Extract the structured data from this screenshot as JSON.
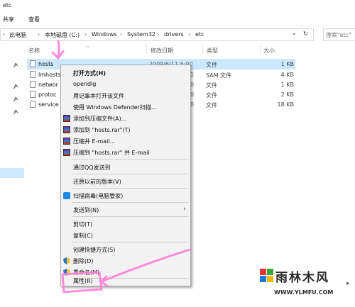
{
  "window": {
    "title": "etc"
  },
  "ribbon": {
    "tabs": [
      "共享",
      "查看"
    ]
  },
  "address": {
    "crumbs": [
      "此电脑",
      "本地磁盘 (C:)",
      "Windows",
      "System32",
      "drivers",
      "etc"
    ],
    "separator": "›",
    "dropdown": "⌄",
    "refresh": "↻"
  },
  "search": {
    "placeholder": "搜索\"etc\""
  },
  "columns": {
    "name": "名称",
    "date": "修改日期",
    "type": "类型",
    "size": "大小"
  },
  "files": [
    {
      "name": "hosts",
      "date": "2009/6/11 5:00",
      "type": "文件",
      "size": "1 KB",
      "selected": true
    },
    {
      "name": "lmhosts",
      "date": "21",
      "type": "SAM 文件",
      "size": "4 KB",
      "selected": false
    },
    {
      "name": "networ",
      "date": "0",
      "type": "文件",
      "size": "1 KB",
      "selected": false
    },
    {
      "name": "protoc",
      "date": "0",
      "type": "文件",
      "size": "2 KB",
      "selected": false
    },
    {
      "name": "service",
      "date": "0",
      "type": "文件",
      "size": "18 KB",
      "selected": false
    }
  ],
  "context_menu": {
    "open_with": "打开方式(H)",
    "opendlg": "opendlg",
    "notepad": "用记事本打开该文件",
    "defender": "使用 Windows Defender扫描...",
    "add_archive": "添加到压缩文件(A)...",
    "add_rar": "添加到 \"hosts.rar\"(T)",
    "compress_email": "压缩并 E-mail...",
    "compress_rar_email": "压缩到 \"hosts.rar\" 并 E-mail",
    "qq_send": "通过QQ发送到",
    "restore": "还原以前的版本(V)",
    "scan_virus": "扫描病毒(电脑管家)",
    "send_to": "发送到(N)",
    "cut": "剪切(T)",
    "copy": "复制(C)",
    "shortcut": "创建快捷方式(S)",
    "delete": "删除(D)",
    "rename": "重命名(M)",
    "properties": "属性(R)"
  },
  "watermark": {
    "name": "雨林木风",
    "url": "WWW.YLMFU.COM"
  },
  "colors": {
    "selection": "#cce8ff",
    "annotation": "#ff6fd0",
    "menu_bg": "#f2f2f2"
  }
}
